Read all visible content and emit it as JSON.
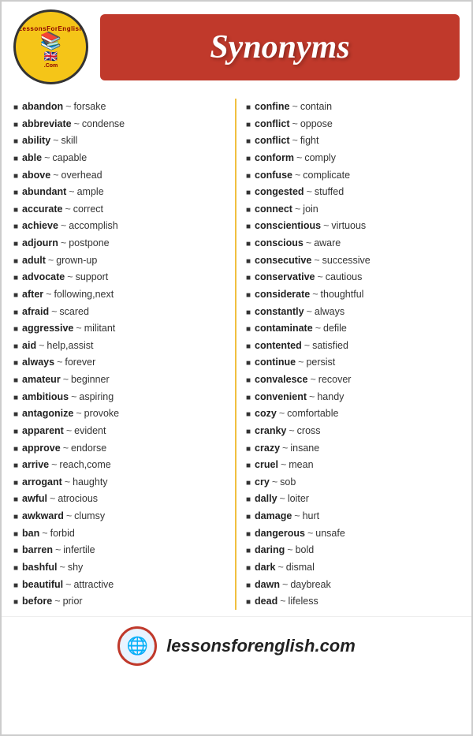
{
  "header": {
    "logo_books": "📚",
    "logo_flag": "🇬🇧",
    "logo_text_top": "LessonsForEnglish",
    "logo_text_bottom": ".Com",
    "title": "Synonyms"
  },
  "left_column": [
    {
      "word": "abandon",
      "synonym": "forsake"
    },
    {
      "word": "abbreviate",
      "synonym": "condense"
    },
    {
      "word": "ability",
      "synonym": "skill"
    },
    {
      "word": "able",
      "synonym": "capable"
    },
    {
      "word": "above",
      "synonym": "overhead"
    },
    {
      "word": "abundant",
      "synonym": "ample"
    },
    {
      "word": "accurate",
      "synonym": "correct"
    },
    {
      "word": "achieve",
      "synonym": "accomplish"
    },
    {
      "word": "adjourn",
      "synonym": "postpone"
    },
    {
      "word": "adult",
      "synonym": "grown-up"
    },
    {
      "word": "advocate",
      "synonym": "support"
    },
    {
      "word": "after",
      "synonym": "following,next"
    },
    {
      "word": "afraid",
      "synonym": "scared"
    },
    {
      "word": "aggressive",
      "synonym": "militant"
    },
    {
      "word": "aid",
      "synonym": "help,assist"
    },
    {
      "word": "always",
      "synonym": "forever"
    },
    {
      "word": "amateur",
      "synonym": "beginner"
    },
    {
      "word": "ambitious",
      "synonym": "aspiring"
    },
    {
      "word": "antagonize",
      "synonym": "provoke"
    },
    {
      "word": "apparent",
      "synonym": "evident"
    },
    {
      "word": "approve",
      "synonym": "endorse"
    },
    {
      "word": "arrive",
      "synonym": "reach,come"
    },
    {
      "word": "arrogant",
      "synonym": "haughty"
    },
    {
      "word": "awful",
      "synonym": "atrocious"
    },
    {
      "word": "awkward",
      "synonym": "clumsy"
    },
    {
      "word": "ban",
      "synonym": "forbid"
    },
    {
      "word": "barren",
      "synonym": "infertile"
    },
    {
      "word": "bashful",
      "synonym": "shy"
    },
    {
      "word": "beautiful",
      "synonym": "attractive"
    },
    {
      "word": "before",
      "synonym": "prior"
    }
  ],
  "right_column": [
    {
      "word": "confine",
      "synonym": "contain"
    },
    {
      "word": "conflict",
      "synonym": "oppose"
    },
    {
      "word": "conflict",
      "synonym": "fight"
    },
    {
      "word": "conform",
      "synonym": "comply"
    },
    {
      "word": "confuse",
      "synonym": "complicate"
    },
    {
      "word": "congested",
      "synonym": "stuffed"
    },
    {
      "word": "connect",
      "synonym": "join"
    },
    {
      "word": "conscientious",
      "synonym": "virtuous"
    },
    {
      "word": "conscious",
      "synonym": "aware"
    },
    {
      "word": "consecutive",
      "synonym": "successive"
    },
    {
      "word": "conservative",
      "synonym": "cautious"
    },
    {
      "word": "considerate",
      "synonym": "thoughtful"
    },
    {
      "word": "constantly",
      "synonym": "always"
    },
    {
      "word": "contaminate",
      "synonym": "defile"
    },
    {
      "word": "contented",
      "synonym": "satisfied"
    },
    {
      "word": "continue",
      "synonym": "persist"
    },
    {
      "word": "convalesce",
      "synonym": "recover"
    },
    {
      "word": "convenient",
      "synonym": "handy"
    },
    {
      "word": "cozy",
      "synonym": "comfortable"
    },
    {
      "word": "cranky",
      "synonym": "cross"
    },
    {
      "word": "crazy",
      "synonym": "insane"
    },
    {
      "word": "cruel",
      "synonym": "mean"
    },
    {
      "word": "cry",
      "synonym": "sob"
    },
    {
      "word": "dally",
      "synonym": "loiter"
    },
    {
      "word": "damage",
      "synonym": "hurt"
    },
    {
      "word": "dangerous",
      "synonym": "unsafe"
    },
    {
      "word": "daring",
      "synonym": "bold"
    },
    {
      "word": "dark",
      "synonym": "dismal"
    },
    {
      "word": "dawn",
      "synonym": "daybreak"
    },
    {
      "word": "dead",
      "synonym": "lifeless"
    }
  ],
  "footer": {
    "globe_icon": "🌐",
    "url": "lessonsforenglish.com"
  }
}
